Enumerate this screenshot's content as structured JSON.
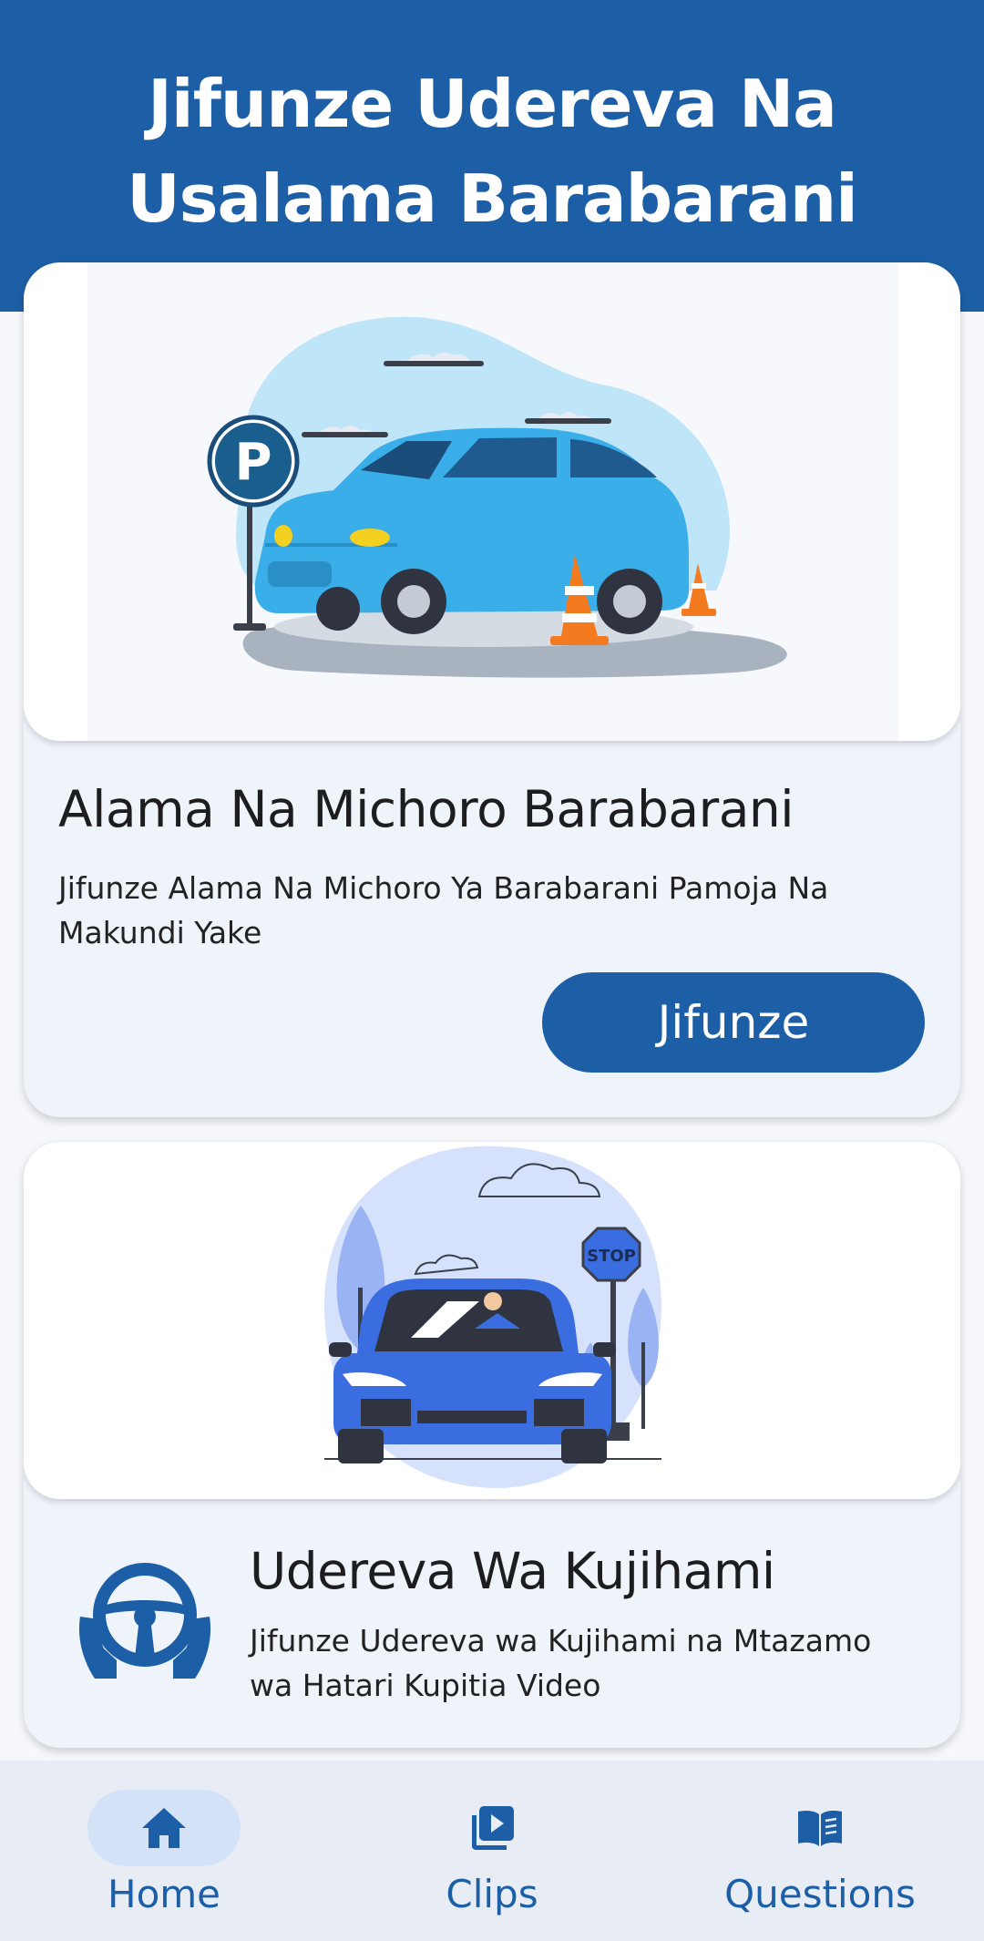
{
  "header": {
    "title_line1": "Jifunze Udereva Na",
    "title_line2": "Usalama Barabarani"
  },
  "cards": [
    {
      "title": "Alama Na Michoro Barabarani",
      "description": "Jifunze Alama Na Michoro Ya Barabarani Pamoja Na Makundi Yake",
      "button_label": "Jifunze",
      "illustration": "parking-car-illustration",
      "sign_letter": "P"
    },
    {
      "title": "Udereva Wa Kujihami",
      "description": "Jifunze Udereva wa Kujihami na Mtazamo wa Hatari Kupitia Video",
      "icon": "steering-wheel-hands-icon",
      "illustration": "stop-sign-car-illustration",
      "sign_text": "STOP"
    }
  ],
  "bottom_nav": {
    "items": [
      {
        "label": "Home",
        "icon": "home-icon",
        "active": true
      },
      {
        "label": "Clips",
        "icon": "video-clips-icon",
        "active": false
      },
      {
        "label": "Questions",
        "icon": "book-icon",
        "active": false
      }
    ]
  },
  "colors": {
    "primary": "#1d5fa6",
    "card_bg": "#eff3fa",
    "nav_active_pill": "#d4e2f7"
  }
}
